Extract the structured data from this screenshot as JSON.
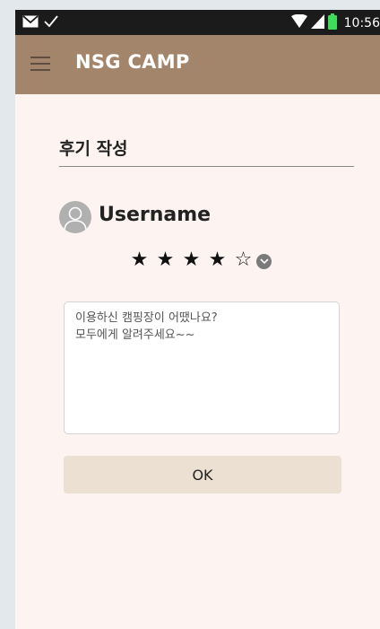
{
  "status_bar": {
    "time": "10:56",
    "icons": [
      "mail-icon",
      "check-icon",
      "wifi-icon",
      "signal-icon",
      "battery-icon"
    ]
  },
  "app_bar": {
    "title": "NSG CAMP",
    "menu_icon": "hamburger-menu-icon",
    "background_color": "#a3856b"
  },
  "review": {
    "section_title": "후기 작성",
    "username": "Username",
    "rating": 4,
    "rating_max": 5,
    "text": "이용하신 캠핑장이 어땠나요?\n모두에게 알려주세요~~",
    "submit_label": "OK"
  },
  "colors": {
    "page_background": "#fdf4f1",
    "button_background": "#ebe0d1",
    "status_bar": "#1b1b1b",
    "battery": "#3ddc5a"
  }
}
